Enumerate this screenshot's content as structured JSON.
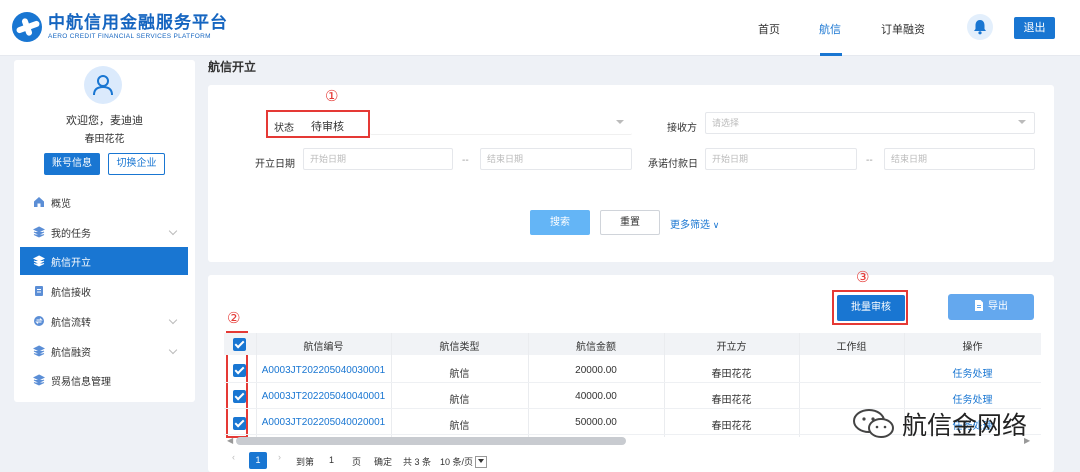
{
  "header": {
    "logo_cn": "中航信用金融服务平台",
    "logo_en": "AERO CREDIT FINANCIAL SERVICES PLATFORM",
    "nav": [
      "首页",
      "航信",
      "订单融资"
    ],
    "active_nav": "航信",
    "logout_label": "退出"
  },
  "sidebar": {
    "welcome": "欢迎您，麦迪迪",
    "company": "春田花花",
    "account_btn": "账号信息",
    "switch_btn": "切换企业",
    "items": [
      {
        "label": "概览",
        "icon": "home-icon"
      },
      {
        "label": "我的任务",
        "icon": "layers-icon"
      },
      {
        "label": "航信开立",
        "icon": "layers-icon",
        "active": true
      },
      {
        "label": "航信接收",
        "icon": "document-icon"
      },
      {
        "label": "航信流转",
        "icon": "transfer-icon"
      },
      {
        "label": "航信融资",
        "icon": "layers-icon"
      },
      {
        "label": "贸易信息管理",
        "icon": "layers-icon"
      }
    ]
  },
  "main": {
    "title": "航信开立",
    "filters": {
      "status_label": "状态",
      "status_value": "待审核",
      "receiver_label": "接收方",
      "receiver_placeholder": "请选择",
      "open_date_label": "开立日期",
      "start_placeholder": "开始日期",
      "end_placeholder": "结束日期",
      "range_sep": "--",
      "promise_date_label": "承诺付款日",
      "search_btn": "搜索",
      "reset_btn": "重置",
      "more_filter": "更多筛选"
    },
    "annotations": [
      "①",
      "②",
      "③"
    ],
    "batch_btn": "批量审核",
    "export_btn": "导出",
    "table": {
      "columns": [
        "航信编号",
        "航信类型",
        "航信金额",
        "开立方",
        "工作组",
        "操作"
      ],
      "rows": [
        {
          "id": "A0003JT202205040030001",
          "type": "航信",
          "amount": "20000.00",
          "issuer": "春田花花",
          "group": "",
          "action": "任务处理"
        },
        {
          "id": "A0003JT202205040040001",
          "type": "航信",
          "amount": "40000.00",
          "issuer": "春田花花",
          "group": "",
          "action": "任务处理"
        },
        {
          "id": "A0003JT202205040020001",
          "type": "航信",
          "amount": "50000.00",
          "issuer": "春田花花",
          "group": "",
          "action": "任务处理"
        }
      ]
    },
    "pager": {
      "current": "1",
      "goto_label": "到第",
      "goto_value": "1",
      "page_unit": "页",
      "confirm": "确定",
      "total": "共 3 条",
      "page_size": "10 条/页"
    }
  },
  "watermark": "航信金网络",
  "colors": {
    "primary": "#1976d2",
    "annotation": "#e53935"
  }
}
